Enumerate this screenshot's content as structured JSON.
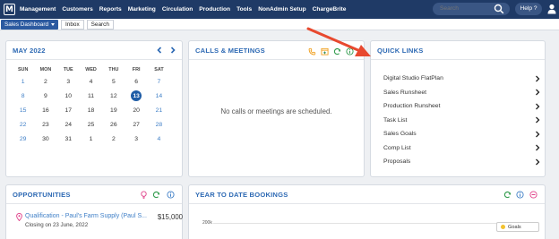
{
  "nav": {
    "logo": "M",
    "menu": [
      "Management",
      "Customers",
      "Reports",
      "Marketing",
      "Circulation",
      "Production",
      "Tools",
      "NonAdmin Setup",
      "ChargeBrite"
    ],
    "search_placeholder": "Search",
    "help_label": "Help ?"
  },
  "subbar": {
    "dashboard_select": "Sales Dashboard",
    "inbox": "Inbox",
    "search": "Search"
  },
  "calendar": {
    "title": "MAY 2022",
    "weekdays": [
      "SUN",
      "MON",
      "TUE",
      "WED",
      "THU",
      "FRI",
      "SAT"
    ],
    "weeks": [
      [
        "1",
        "2",
        "3",
        "4",
        "5",
        "6",
        "7"
      ],
      [
        "8",
        "9",
        "10",
        "11",
        "12",
        "13",
        "14"
      ],
      [
        "15",
        "16",
        "17",
        "18",
        "19",
        "20",
        "21"
      ],
      [
        "22",
        "23",
        "24",
        "25",
        "26",
        "27",
        "28"
      ],
      [
        "29",
        "30",
        "31",
        "1",
        "2",
        "3",
        "4"
      ]
    ],
    "today": "13"
  },
  "calls": {
    "title": "CALLS & MEETINGS",
    "empty_message": "No calls or meetings are scheduled."
  },
  "quick_links": {
    "title": "QUICK LINKS",
    "items": [
      "Digital Studio FlatPlan",
      "Sales Runsheet",
      "Production Runsheet",
      "Task List",
      "Sales Goals",
      "Comp List",
      "Proposals"
    ]
  },
  "opportunities": {
    "title": "OPPORTUNITIES",
    "item": {
      "title": "Qualification - Paul's Farm Supply (Paul S...",
      "subtitle": "Closing on 23 June, 2022",
      "amount": "$15,000"
    }
  },
  "ytd": {
    "title": "YEAR TO DATE BOOKINGS",
    "y_tick": "200k",
    "legend": "Goals"
  },
  "colors": {
    "nav_bg": "#1f3a66",
    "accent": "#2e6ab4",
    "today_bg": "#1f5da6",
    "arrow": "#e8492f",
    "legend_goals": "#f2c230"
  }
}
